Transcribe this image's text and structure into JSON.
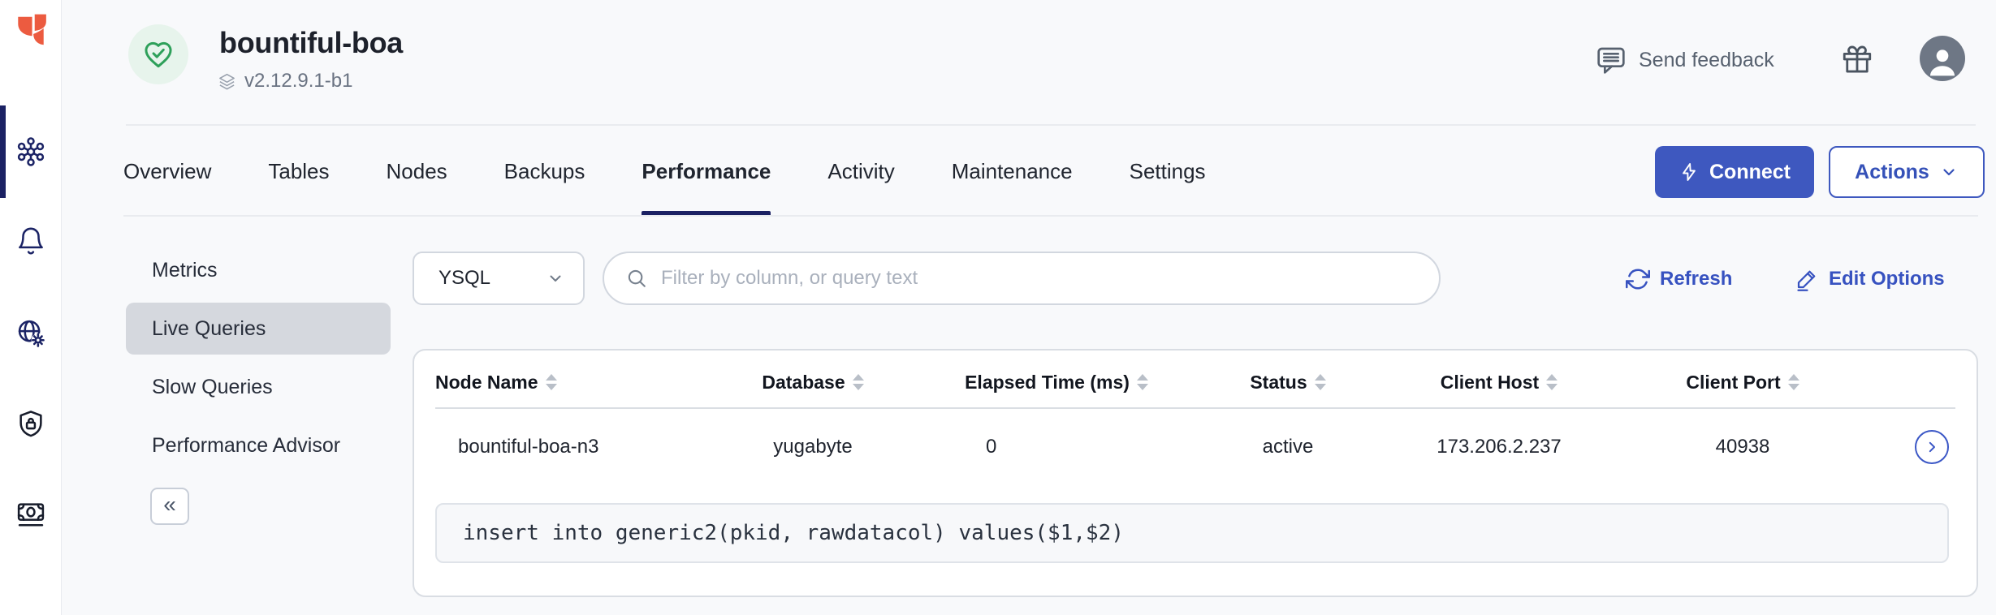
{
  "colors": {
    "accent_blue": "#3E58BF",
    "navy": "#1B2163",
    "logo_orange": "#EC5B40",
    "health_green": "#2EA05A",
    "selected_pill": "#D5D8DE",
    "page_bg": "#F8F9FB"
  },
  "sidebar": {
    "icons": [
      "yugabyte-logo",
      "clusters",
      "alerts",
      "network",
      "security",
      "billing"
    ]
  },
  "header": {
    "cluster_name": "bountiful-boa",
    "version": "v2.12.9.1-b1",
    "send_feedback": "Send feedback"
  },
  "tabs": {
    "items": [
      "Overview",
      "Tables",
      "Nodes",
      "Backups",
      "Performance",
      "Activity",
      "Maintenance",
      "Settings"
    ],
    "active": "Performance"
  },
  "toolbar": {
    "connect": "Connect",
    "actions": "Actions"
  },
  "subnav": {
    "items": [
      "Metrics",
      "Live Queries",
      "Slow Queries",
      "Performance Advisor"
    ],
    "active": "Live Queries",
    "collapse": "«"
  },
  "filters": {
    "api": "YSQL",
    "placeholder": "Filter by column, or query text",
    "refresh": "Refresh",
    "edit_options": "Edit Options"
  },
  "live_queries": {
    "columns": [
      "Node Name",
      "Database",
      "Elapsed Time (ms)",
      "Status",
      "Client Host",
      "Client Port"
    ],
    "rows": [
      {
        "node_name": "bountiful-boa-n3",
        "database": "yugabyte",
        "elapsed_ms": "0",
        "status": "active",
        "client_host": "173.206.2.237",
        "client_port": "40938",
        "query": "insert into generic2(pkid, rawdatacol) values($1,$2)"
      }
    ]
  }
}
